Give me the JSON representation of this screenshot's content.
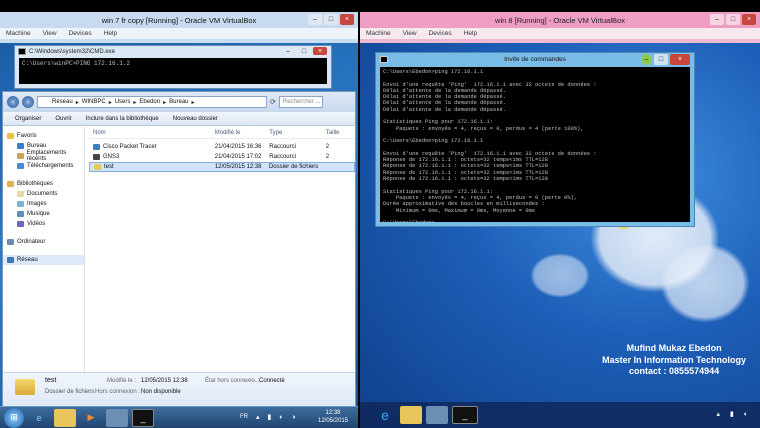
{
  "left_vm": {
    "title": "win 7 fr copy [Running] - Oracle VM VirtualBox",
    "menu": [
      "Machine",
      "View",
      "Devices",
      "Help"
    ],
    "cmd_title": "C:\\Windows\\system32\\CMD.exe",
    "cmd_line": "C:\\Users\\winPC>PING 172.16.1.2",
    "explorer": {
      "breadcrumb": [
        "Réseau",
        "WINBPC",
        "Users",
        "Ebedon",
        "Bureau"
      ],
      "search_placeholder": "Rechercher ...",
      "toolbar": [
        "Organiser",
        "Ouvrir",
        "Inclure dans la bibliothèque",
        "Nouveau dossier"
      ],
      "nav": {
        "favorites": "Favoris",
        "fav_items": [
          "Bureau",
          "Emplacements récents",
          "Téléchargements"
        ],
        "libraries": "Bibliothèques",
        "lib_items": [
          "Documents",
          "Images",
          "Musique",
          "Vidéos"
        ],
        "computer": "Ordinateur",
        "network": "Réseau"
      },
      "columns": [
        "Nom",
        "Modifié le",
        "Type",
        "Taille"
      ],
      "rows": [
        {
          "name": "Cisco Packet Tracer",
          "date": "21/04/2015 16:36",
          "type": "Raccourci",
          "size": "2"
        },
        {
          "name": "GNS3",
          "date": "21/04/2015 17:02",
          "type": "Raccourci",
          "size": "2"
        },
        {
          "name": "test",
          "date": "12/05/2015 12:38",
          "type": "Dossier de fichiers",
          "size": ""
        }
      ],
      "details": {
        "name": "test",
        "type": "Dossier de fichiers",
        "modified_label": "Modifié le :",
        "modified_value": "12/05/2015 12:38",
        "state_label": "État hors connexio...",
        "state_value": "Connecté",
        "offline_label": "Hors connexion :",
        "offline_value": "Non disponible"
      }
    },
    "taskbar": {
      "lang": "FR",
      "time": "12:38",
      "date": "12/05/2015"
    }
  },
  "right_vm": {
    "title": "win 8 [Running] - Oracle VM VirtualBox",
    "menu": [
      "Machine",
      "View",
      "Devices",
      "Help"
    ],
    "cmd_title": "Invite de commandes",
    "console": "C:\\Users\\Ebedon>ping 172.16.1.1\n\nEnvoi d'une requête 'Ping'  172.16.1.1 avec 32 octets de données :\nDélai d'attente de la demande dépassé.\nDélai d'attente de la demande dépassé.\nDélai d'attente de la demande dépassé.\nDélai d'attente de la demande dépassé.\n\nStatistiques Ping pour 172.16.1.1:\n    Paquets : envoyés = 4, reçus = 0, perdus = 4 (perte 100%),\n\nC:\\Users\\Ebedon>ping 172.16.1.1\n\nEnvoi d'une requête 'Ping'  172.16.1.1 avec 32 octets de données :\nRéponse de 172.16.1.1 : octets=32 temps<1ms TTL=128\nRéponse de 172.16.1.1 : octets=32 temps<1ms TTL=128\nRéponse de 172.16.1.1 : octets=32 temps<1ms TTL=128\nRéponse de 172.16.1.1 : octets=32 temps<1ms TTL=128\n\nStatistiques Ping pour 172.16.1.1:\n    Paquets : envoyés = 4, reçus = 4, perdus = 0 (perte 0%),\nDurée approximative des boucles en millisecondes :\n    Minimum = 0ms, Maximum = 0ms, Moyenne = 0ms\n\nC:\\Users\\Ebedon>_",
    "credits": [
      "Mufind Mukaz Ebedon",
      "Master In Information Technology",
      "contact : 0855574944"
    ]
  }
}
